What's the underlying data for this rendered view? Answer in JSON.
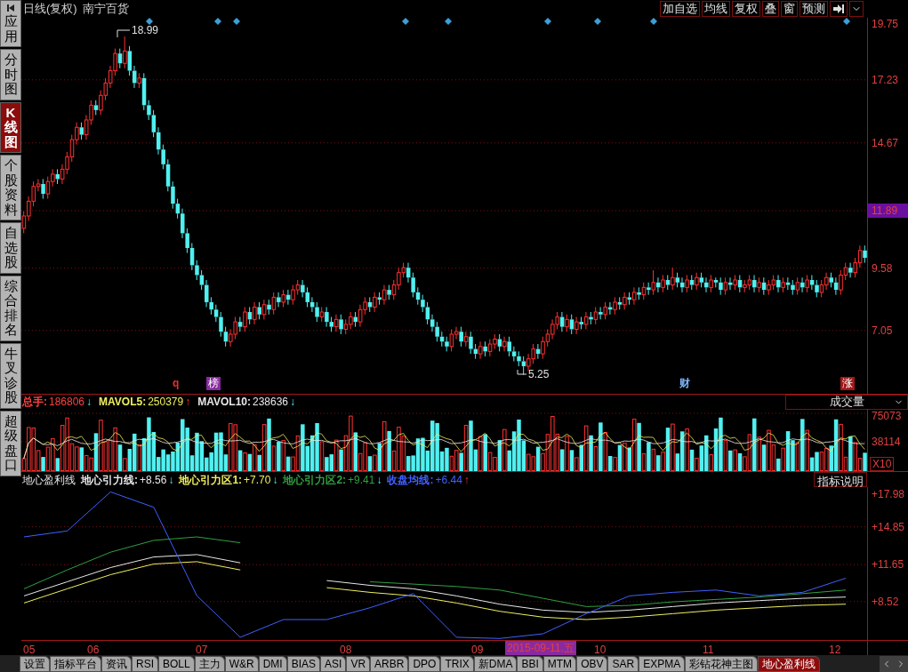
{
  "sidebar": {
    "items": [
      {
        "label": "应用",
        "kind": "apps",
        "selected": false
      },
      {
        "label": "分时图",
        "kind": "tab",
        "selected": false
      },
      {
        "label": "K线图",
        "kind": "tab",
        "selected": true
      },
      {
        "label": "个股资料",
        "kind": "tab",
        "selected": false
      },
      {
        "label": "自选股",
        "kind": "tab",
        "selected": false
      },
      {
        "label": "综合排名",
        "kind": "tab",
        "selected": false
      },
      {
        "label": "牛叉诊股",
        "kind": "tab",
        "selected": false
      },
      {
        "label": "超级盘口",
        "kind": "tab",
        "selected": false
      }
    ]
  },
  "header": {
    "title": "日线(复权)",
    "stock": "南宁百货",
    "buttons": [
      "加自选",
      "均线",
      "复权",
      "叠",
      "窗",
      "预测"
    ]
  },
  "price_chart": {
    "current_price": "11.89",
    "high_label": "18.99",
    "low_label": "5.25",
    "chart_data": {
      "type": "candlestick",
      "grid": true,
      "yticks": [
        {
          "value": 19.75,
          "label": "19.75"
        },
        {
          "value": 17.23,
          "label": "17.23"
        },
        {
          "value": 14.67,
          "label": "14.67"
        },
        {
          "value": 9.58,
          "label": "9.58"
        },
        {
          "value": 7.05,
          "label": "7.05"
        }
      ],
      "ylim": [
        4.48,
        19.75
      ],
      "categories": [
        null,
        null,
        null,
        null,
        null,
        null,
        null,
        null,
        null,
        null,
        null,
        null,
        null,
        null,
        null,
        null,
        null,
        null,
        null,
        null,
        null,
        null,
        null,
        null,
        null,
        null,
        null,
        null,
        null,
        null,
        null,
        null,
        null,
        null,
        null,
        null,
        null,
        null,
        null,
        null,
        null,
        null,
        null,
        null,
        null,
        null,
        null,
        null,
        null,
        null,
        null,
        null,
        null,
        null,
        null,
        null,
        null,
        null,
        null,
        null,
        null,
        null,
        null,
        null,
        null,
        null,
        null,
        null,
        null,
        null,
        null,
        null,
        null,
        null,
        null,
        null,
        null,
        null,
        null,
        null,
        null,
        null,
        null,
        null,
        null,
        null,
        null,
        null,
        null,
        null,
        null,
        null,
        null,
        null,
        null,
        null,
        null,
        null,
        null,
        null,
        null,
        null,
        null,
        null,
        null,
        null,
        null,
        null,
        null,
        null,
        null,
        null,
        null,
        null,
        null,
        null,
        null,
        null,
        null,
        null,
        null,
        null,
        null,
        null,
        null,
        null,
        null,
        null,
        null,
        null,
        null,
        null,
        null,
        null,
        null,
        null,
        null,
        null,
        null,
        null,
        null,
        null,
        null,
        null,
        null,
        null,
        null,
        null,
        null,
        null,
        null,
        null,
        null,
        null,
        null,
        null,
        null,
        null,
        null,
        null,
        null,
        null,
        null,
        null,
        null,
        null,
        null,
        null,
        null,
        null,
        null,
        null,
        null,
        null,
        null,
        null
      ],
      "ohlc": [
        [
          11.2,
          11.9,
          11.0,
          11.7
        ],
        [
          11.7,
          12.5,
          11.5,
          12.3
        ],
        [
          12.3,
          13.1,
          12.1,
          12.9
        ],
        [
          12.9,
          13.2,
          12.7,
          13.0
        ],
        [
          13.0,
          13.2,
          12.4,
          12.6
        ],
        [
          12.6,
          13.3,
          12.4,
          13.1
        ],
        [
          13.1,
          13.6,
          12.9,
          13.4
        ],
        [
          13.4,
          13.6,
          13.0,
          13.2
        ],
        [
          13.2,
          13.8,
          13.0,
          13.6
        ],
        [
          13.6,
          14.3,
          13.4,
          14.1
        ],
        [
          14.1,
          15.0,
          13.9,
          14.8
        ],
        [
          14.8,
          15.5,
          14.6,
          15.3
        ],
        [
          15.3,
          15.5,
          14.8,
          15.0
        ],
        [
          15.0,
          15.8,
          14.8,
          15.6
        ],
        [
          15.6,
          16.4,
          15.4,
          16.2
        ],
        [
          16.2,
          16.4,
          15.8,
          16.0
        ],
        [
          16.0,
          16.8,
          15.8,
          16.6
        ],
        [
          16.6,
          17.3,
          16.4,
          17.1
        ],
        [
          17.1,
          17.8,
          16.9,
          17.6
        ],
        [
          17.6,
          18.5,
          17.4,
          18.3
        ],
        [
          18.3,
          18.5,
          17.7,
          17.9
        ],
        [
          17.9,
          18.99,
          17.7,
          18.4
        ],
        [
          18.4,
          18.6,
          17.4,
          17.6
        ],
        [
          17.6,
          17.8,
          16.9,
          17.1
        ],
        [
          17.1,
          17.5,
          16.9,
          17.3
        ],
        [
          17.3,
          17.5,
          16.0,
          16.2
        ],
        [
          16.2,
          16.4,
          15.6,
          15.8
        ],
        [
          15.8,
          16.0,
          14.9,
          15.1
        ],
        [
          15.1,
          15.3,
          14.2,
          14.4
        ],
        [
          14.4,
          14.6,
          13.6,
          13.8
        ],
        [
          13.8,
          14.0,
          12.7,
          12.9
        ],
        [
          12.9,
          13.1,
          12.0,
          12.2
        ],
        [
          12.2,
          12.4,
          11.6,
          11.8
        ],
        [
          11.8,
          12.0,
          10.8,
          11.0
        ],
        [
          11.0,
          11.2,
          10.2,
          10.4
        ],
        [
          10.4,
          10.6,
          9.5,
          9.7
        ],
        [
          9.7,
          9.9,
          9.1,
          9.3
        ],
        [
          9.3,
          9.5,
          8.7,
          8.9
        ],
        [
          8.9,
          9.1,
          8.0,
          8.2
        ],
        [
          8.2,
          8.4,
          7.7,
          7.9
        ],
        [
          7.9,
          8.1,
          7.4,
          7.6
        ],
        [
          7.6,
          7.8,
          6.8,
          7.0
        ],
        [
          7.0,
          7.2,
          6.4,
          6.6
        ],
        [
          6.6,
          7.1,
          6.4,
          6.9
        ],
        [
          6.9,
          7.6,
          6.7,
          7.4
        ],
        [
          7.4,
          7.6,
          7.0,
          7.2
        ],
        [
          7.2,
          8.0,
          7.0,
          7.8
        ],
        [
          7.8,
          8.0,
          7.3,
          7.5
        ],
        [
          7.5,
          8.2,
          7.3,
          8.0
        ],
        [
          8.0,
          8.2,
          7.5,
          7.7
        ],
        [
          7.7,
          8.3,
          7.5,
          8.1
        ],
        [
          8.1,
          8.3,
          7.7,
          7.9
        ],
        [
          7.9,
          8.6,
          7.7,
          8.4
        ],
        [
          8.4,
          8.6,
          8.0,
          8.2
        ],
        [
          8.2,
          8.7,
          8.0,
          8.5
        ],
        [
          8.5,
          8.7,
          8.1,
          8.3
        ],
        [
          8.3,
          8.9,
          8.1,
          8.7
        ],
        [
          8.7,
          9.1,
          8.5,
          8.9
        ],
        [
          8.9,
          9.1,
          8.4,
          8.6
        ],
        [
          8.6,
          8.8,
          8.0,
          8.2
        ],
        [
          8.2,
          8.4,
          7.8,
          8.0
        ],
        [
          8.0,
          8.2,
          7.4,
          7.6
        ],
        [
          7.6,
          8.0,
          7.4,
          7.8
        ],
        [
          7.8,
          8.0,
          7.2,
          7.4
        ],
        [
          7.4,
          7.6,
          7.0,
          7.2
        ],
        [
          7.2,
          7.7,
          7.0,
          7.5
        ],
        [
          7.5,
          7.7,
          6.9,
          7.1
        ],
        [
          7.1,
          7.5,
          6.9,
          7.3
        ],
        [
          7.3,
          7.8,
          7.1,
          7.6
        ],
        [
          7.6,
          7.8,
          7.2,
          7.4
        ],
        [
          7.4,
          8.1,
          7.2,
          7.9
        ],
        [
          7.9,
          8.4,
          7.7,
          8.2
        ],
        [
          8.2,
          8.4,
          7.8,
          8.0
        ],
        [
          8.0,
          8.6,
          7.8,
          8.4
        ],
        [
          8.4,
          8.6,
          8.1,
          8.3
        ],
        [
          8.3,
          8.9,
          8.1,
          8.7
        ],
        [
          8.7,
          8.9,
          8.3,
          8.5
        ],
        [
          8.5,
          9.1,
          8.3,
          8.9
        ],
        [
          8.9,
          9.6,
          8.7,
          9.4
        ],
        [
          9.4,
          9.8,
          9.2,
          9.6
        ],
        [
          9.6,
          9.8,
          9.0,
          9.2
        ],
        [
          9.2,
          9.4,
          8.4,
          8.6
        ],
        [
          8.6,
          8.8,
          8.1,
          8.3
        ],
        [
          8.3,
          8.5,
          7.8,
          8.0
        ],
        [
          8.0,
          8.2,
          7.3,
          7.5
        ],
        [
          7.5,
          7.7,
          7.0,
          7.2
        ],
        [
          7.2,
          7.4,
          6.6,
          6.8
        ],
        [
          6.8,
          7.0,
          6.4,
          6.6
        ],
        [
          6.6,
          6.8,
          6.2,
          6.4
        ],
        [
          6.4,
          7.1,
          6.2,
          6.9
        ],
        [
          6.9,
          7.2,
          6.7,
          7.0
        ],
        [
          7.0,
          7.2,
          6.4,
          6.6
        ],
        [
          6.6,
          7.0,
          6.4,
          6.8
        ],
        [
          6.8,
          7.0,
          6.1,
          6.3
        ],
        [
          6.3,
          6.5,
          5.9,
          6.1
        ],
        [
          6.1,
          6.6,
          5.9,
          6.4
        ],
        [
          6.4,
          6.6,
          6.0,
          6.2
        ],
        [
          6.2,
          6.7,
          6.0,
          6.5
        ],
        [
          6.5,
          6.9,
          6.3,
          6.7
        ],
        [
          6.7,
          6.9,
          6.2,
          6.4
        ],
        [
          6.4,
          6.8,
          6.2,
          6.6
        ],
        [
          6.6,
          6.8,
          6.0,
          6.2
        ],
        [
          6.2,
          6.4,
          5.8,
          6.0
        ],
        [
          6.0,
          6.2,
          5.6,
          5.8
        ],
        [
          5.8,
          6.0,
          5.25,
          5.6
        ],
        [
          5.6,
          6.1,
          5.4,
          5.9
        ],
        [
          5.9,
          6.5,
          5.7,
          6.3
        ],
        [
          6.3,
          6.5,
          5.9,
          6.1
        ],
        [
          6.1,
          6.8,
          5.9,
          6.6
        ],
        [
          6.6,
          7.1,
          6.4,
          6.9
        ],
        [
          6.9,
          7.5,
          6.7,
          7.3
        ],
        [
          7.3,
          7.8,
          7.1,
          7.6
        ],
        [
          7.6,
          7.8,
          7.0,
          7.2
        ],
        [
          7.2,
          7.7,
          7.0,
          7.5
        ],
        [
          7.5,
          7.7,
          6.9,
          7.1
        ],
        [
          7.1,
          7.6,
          6.9,
          7.4
        ],
        [
          7.4,
          7.6,
          7.1,
          7.3
        ],
        [
          7.3,
          7.8,
          7.1,
          7.6
        ],
        [
          7.6,
          7.8,
          7.3,
          7.5
        ],
        [
          7.5,
          8.0,
          7.3,
          7.8
        ],
        [
          7.8,
          8.0,
          7.5,
          7.7
        ],
        [
          7.7,
          8.2,
          7.5,
          8.0
        ],
        [
          8.0,
          8.2,
          7.7,
          7.9
        ],
        [
          7.9,
          8.4,
          7.7,
          8.2
        ],
        [
          8.2,
          8.4,
          7.9,
          8.1
        ],
        [
          8.1,
          8.6,
          7.9,
          8.4
        ],
        [
          8.4,
          8.6,
          8.1,
          8.3
        ],
        [
          8.3,
          8.8,
          8.1,
          8.6
        ],
        [
          8.6,
          8.8,
          8.3,
          8.5
        ],
        [
          8.5,
          9.0,
          8.3,
          8.8
        ],
        [
          8.8,
          9.0,
          8.5,
          8.7
        ],
        [
          8.7,
          9.5,
          8.5,
          9.0
        ],
        [
          9.0,
          9.2,
          8.6,
          8.8
        ],
        [
          8.8,
          9.3,
          8.6,
          9.1
        ],
        [
          9.1,
          9.3,
          8.7,
          8.9
        ],
        [
          8.9,
          9.6,
          8.7,
          9.2
        ],
        [
          9.2,
          9.4,
          8.8,
          9.0
        ],
        [
          9.0,
          9.2,
          8.6,
          8.8
        ],
        [
          8.8,
          9.3,
          8.6,
          9.1
        ],
        [
          9.1,
          9.3,
          8.7,
          8.9
        ],
        [
          8.9,
          9.4,
          8.7,
          9.2
        ],
        [
          9.2,
          9.4,
          8.8,
          9.0
        ],
        [
          9.0,
          9.2,
          8.6,
          8.8
        ],
        [
          8.8,
          9.3,
          8.6,
          9.1
        ],
        [
          9.1,
          9.2,
          8.8,
          9.0
        ],
        [
          9.0,
          9.2,
          8.5,
          8.7
        ],
        [
          8.7,
          9.2,
          8.5,
          9.0
        ],
        [
          9.0,
          9.2,
          8.7,
          8.9
        ],
        [
          8.9,
          9.3,
          8.7,
          9.1
        ],
        [
          9.1,
          9.3,
          8.6,
          8.8
        ],
        [
          8.8,
          9.1,
          8.6,
          8.9
        ],
        [
          8.9,
          9.3,
          8.7,
          9.1
        ],
        [
          9.1,
          9.3,
          8.6,
          8.8
        ],
        [
          8.8,
          9.2,
          8.6,
          9.0
        ],
        [
          9.0,
          9.2,
          8.5,
          8.7
        ],
        [
          8.7,
          9.1,
          8.5,
          8.9
        ],
        [
          8.9,
          9.3,
          8.7,
          9.1
        ],
        [
          9.1,
          9.3,
          8.6,
          8.8
        ],
        [
          8.8,
          9.2,
          8.6,
          9.0
        ],
        [
          9.0,
          9.2,
          8.7,
          8.9
        ],
        [
          8.9,
          9.1,
          8.5,
          8.7
        ],
        [
          8.7,
          9.2,
          8.5,
          9.0
        ],
        [
          9.0,
          9.2,
          8.6,
          8.8
        ],
        [
          8.8,
          9.3,
          8.6,
          9.1
        ],
        [
          9.1,
          9.3,
          8.7,
          8.9
        ],
        [
          8.9,
          9.1,
          8.4,
          8.6
        ],
        [
          8.6,
          9.1,
          8.4,
          8.9
        ],
        [
          8.9,
          9.4,
          8.7,
          9.2
        ],
        [
          9.2,
          9.4,
          8.8,
          9.0
        ],
        [
          9.0,
          9.2,
          8.5,
          8.7
        ],
        [
          8.7,
          9.5,
          8.5,
          9.3
        ],
        [
          9.3,
          9.8,
          9.1,
          9.6
        ],
        [
          9.6,
          9.8,
          9.2,
          9.4
        ],
        [
          9.4,
          10.0,
          9.2,
          9.8
        ],
        [
          9.8,
          10.5,
          9.6,
          10.3
        ],
        [
          10.3,
          10.5,
          9.8,
          10.0
        ]
      ]
    },
    "event_marks": [
      {
        "text": "q",
        "kind": "plain",
        "color": "#e83030"
      },
      {
        "text": "榜",
        "kind": "boxed",
        "color": "#8a2aa0"
      },
      {
        "text": "财",
        "kind": "plain",
        "color": "#7fb8ff"
      },
      {
        "text": "涨",
        "kind": "boxed",
        "color": "#a01818"
      }
    ]
  },
  "volume": {
    "legend": [
      {
        "label": "总手:",
        "value": "186806",
        "trend": "↓",
        "color": "#ff4040"
      },
      {
        "label": "MAVOL5:",
        "value": "250379",
        "trend": "↑",
        "color": "#f0f060"
      },
      {
        "label": "MAVOL10:",
        "value": "238636",
        "trend": "↓",
        "color": "#e8e8e8"
      }
    ],
    "selector": "成交量",
    "y_ticks": [
      "75073",
      "38114"
    ],
    "unit": "X10"
  },
  "indicator": {
    "name": "地心盈利线",
    "legend": [
      {
        "label": "地心引力线:",
        "value": "+8.56",
        "trend": "↓",
        "color": "#e8e8e8"
      },
      {
        "label": "地心引力区1:",
        "value": "+7.70",
        "trend": "↓",
        "color": "#f0f060"
      },
      {
        "label": "地心引力区2:",
        "value": "+9.41",
        "trend": "↓",
        "color": "#30a040"
      },
      {
        "label": "收盘均线:",
        "value": "+6.44",
        "trend": "↑",
        "color": "#4060ff"
      }
    ],
    "help_button": "指标说明",
    "chart_data": {
      "type": "line",
      "grid": true,
      "ylim": [
        5.27,
        18.21
      ],
      "categories": [
        null,
        null,
        null,
        null,
        null,
        null,
        null,
        null,
        null,
        null,
        null,
        null,
        null,
        null,
        null,
        null,
        null,
        null,
        null,
        null
      ],
      "yticks": [
        {
          "value": 17.98,
          "label": "+17.98"
        },
        {
          "value": 14.85,
          "label": "+14.85"
        },
        {
          "value": 11.65,
          "label": "+11.65"
        },
        {
          "value": 8.52,
          "label": "+8.52"
        }
      ],
      "series": [
        {
          "color": "#30a040",
          "values": [
            9.6,
            11.2,
            12.7,
            13.7,
            14,
            13.5,
            null,
            null,
            10.2,
            10,
            9.8,
            9.5,
            8.8,
            8.1,
            8.2,
            8.5,
            8.7,
            8.9,
            9.2,
            9.5
          ]
        },
        {
          "color": "#e8e8e8",
          "values": [
            9,
            10.2,
            11.4,
            12.3,
            12.5,
            11.8,
            null,
            10.3,
            9.9,
            9.6,
            9,
            8.3,
            7.8,
            7.6,
            7.8,
            8.1,
            8.4,
            8.6,
            8.8,
            8.9
          ]
        },
        {
          "color": "#f0f060",
          "values": [
            8.4,
            9.6,
            10.8,
            11.7,
            11.9,
            11.2,
            null,
            9.7,
            9.3,
            9,
            8.4,
            7.7,
            7.2,
            7,
            7.2,
            7.5,
            7.8,
            8,
            8.2,
            8.3
          ]
        },
        {
          "color": "#4060ff",
          "values": [
            14,
            14.5,
            17.8,
            16.5,
            9,
            5.5,
            7,
            7,
            8,
            9.2,
            5.5,
            5.4,
            5.8,
            7.5,
            9,
            9.3,
            9.5,
            9,
            9.3,
            10.5
          ]
        }
      ]
    }
  },
  "x_axis": {
    "labels": [
      "05",
      "06",
      "07",
      "08",
      "09",
      "10",
      "11",
      "12"
    ],
    "cursor_date": "2015-09-11.五"
  },
  "bottom_tabs": [
    {
      "label": "设置",
      "selected": false
    },
    {
      "label": "指标平台",
      "selected": false
    },
    {
      "label": "资讯",
      "selected": false
    },
    {
      "label": "RSI",
      "selected": false
    },
    {
      "label": "BOLL",
      "selected": false
    },
    {
      "label": "主力",
      "selected": false
    },
    {
      "label": "W&R",
      "selected": false
    },
    {
      "label": "DMI",
      "selected": false
    },
    {
      "label": "BIAS",
      "selected": false
    },
    {
      "label": "ASI",
      "selected": false
    },
    {
      "label": "VR",
      "selected": false
    },
    {
      "label": "ARBR",
      "selected": false
    },
    {
      "label": "DPO",
      "selected": false
    },
    {
      "label": "TRIX",
      "selected": false
    },
    {
      "label": "新DMA",
      "selected": false
    },
    {
      "label": "BBI",
      "selected": false
    },
    {
      "label": "MTM",
      "selected": false
    },
    {
      "label": "OBV",
      "selected": false
    },
    {
      "label": "SAR",
      "selected": false
    },
    {
      "label": "EXPMA",
      "selected": false
    },
    {
      "label": "彩钻花神主图",
      "selected": false
    },
    {
      "label": "地心盈利线",
      "selected": true
    }
  ]
}
